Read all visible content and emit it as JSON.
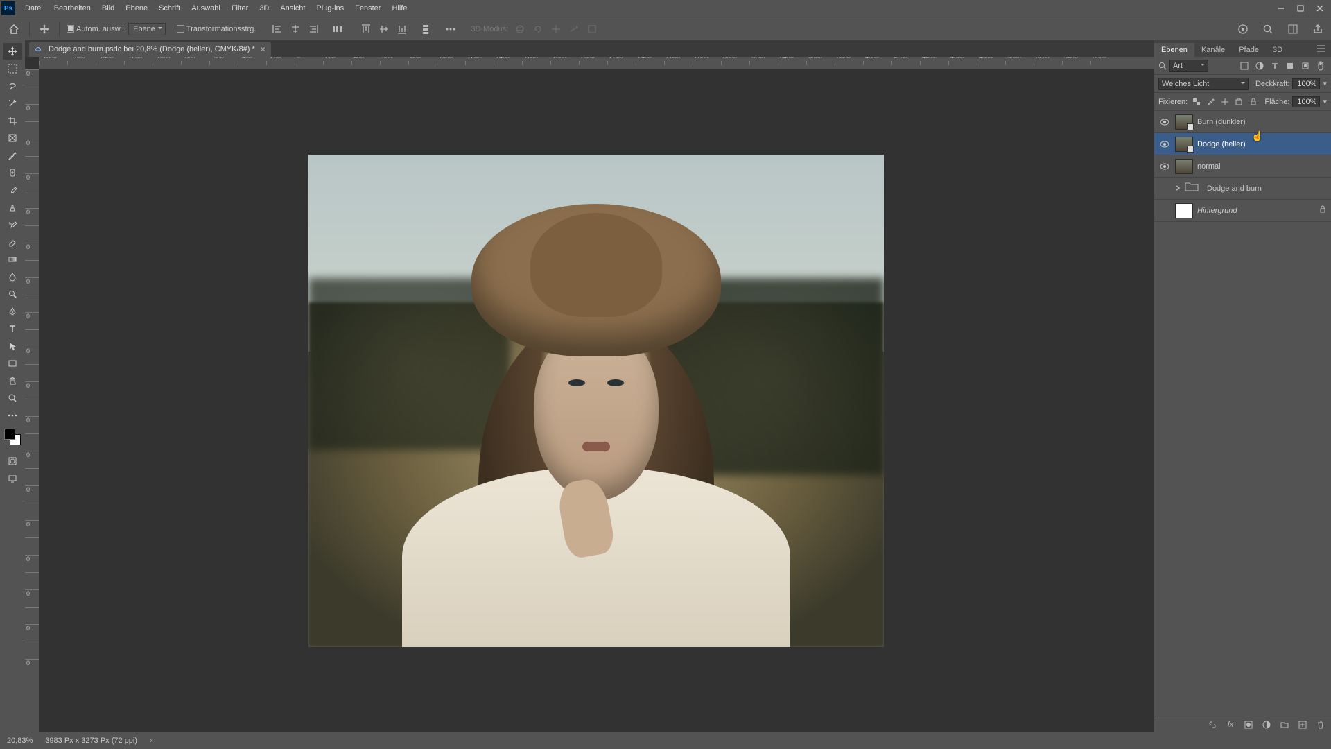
{
  "menu": {
    "items": [
      "Datei",
      "Bearbeiten",
      "Bild",
      "Ebene",
      "Schrift",
      "Auswahl",
      "Filter",
      "3D",
      "Ansicht",
      "Plug-ins",
      "Fenster",
      "Hilfe"
    ]
  },
  "options": {
    "auto_select_label": "Autom. ausw.:",
    "auto_select_value": "Ebene",
    "transform_label": "Transformationsstrg.",
    "mode_label": "3D-Modus:"
  },
  "doc_tab": {
    "title": "Dodge and burn.psdc bei 20,8% (Dodge (heller), CMYK/8#) *"
  },
  "ruler_h": [
    "-1800",
    "-1600",
    "-1400",
    "-1200",
    "-1000",
    "-800",
    "-600",
    "-400",
    "-200",
    "0",
    "200",
    "400",
    "600",
    "800",
    "1000",
    "1200",
    "1400",
    "1600",
    "1800",
    "2000",
    "2200",
    "2400",
    "2600",
    "2800",
    "3000",
    "3200",
    "3400",
    "3600",
    "3800",
    "4000",
    "4200",
    "4400",
    "4600",
    "4800",
    "5000",
    "5200",
    "5400",
    "5600"
  ],
  "ruler_v": [
    "0",
    "",
    "0",
    "",
    "0",
    "",
    "0",
    "",
    "0",
    "",
    "0",
    "",
    "0",
    "",
    "0",
    "",
    "0",
    "",
    "0",
    "",
    "0",
    "",
    "0",
    "",
    "0",
    "",
    "0",
    "",
    "0",
    "",
    "0",
    "",
    "0",
    "",
    "0"
  ],
  "panel": {
    "tabs": [
      "Ebenen",
      "Kanäle",
      "Pfade",
      "3D"
    ],
    "filter_label": "Art",
    "blend_mode": "Weiches Licht",
    "opacity_label": "Deckkraft:",
    "opacity_value": "100%",
    "lock_label": "Fixieren:",
    "fill_label": "Fläche:",
    "fill_value": "100%"
  },
  "layers": [
    {
      "name": "Burn (dunkler)",
      "visible": true,
      "selected": false,
      "thumb": "img",
      "mask": true
    },
    {
      "name": "Dodge (heller)",
      "visible": true,
      "selected": true,
      "thumb": "img",
      "mask": true
    },
    {
      "name": "normal",
      "visible": true,
      "selected": false,
      "thumb": "img",
      "mask": false
    },
    {
      "name": "Dodge and burn",
      "visible": false,
      "selected": false,
      "thumb": "group",
      "mask": false
    },
    {
      "name": "Hintergrund",
      "visible": false,
      "selected": false,
      "thumb": "white",
      "mask": false,
      "italic": true,
      "locked": true
    }
  ],
  "status": {
    "zoom": "20,83%",
    "dims": "3983 Px x 3273 Px (72 ppi)"
  }
}
